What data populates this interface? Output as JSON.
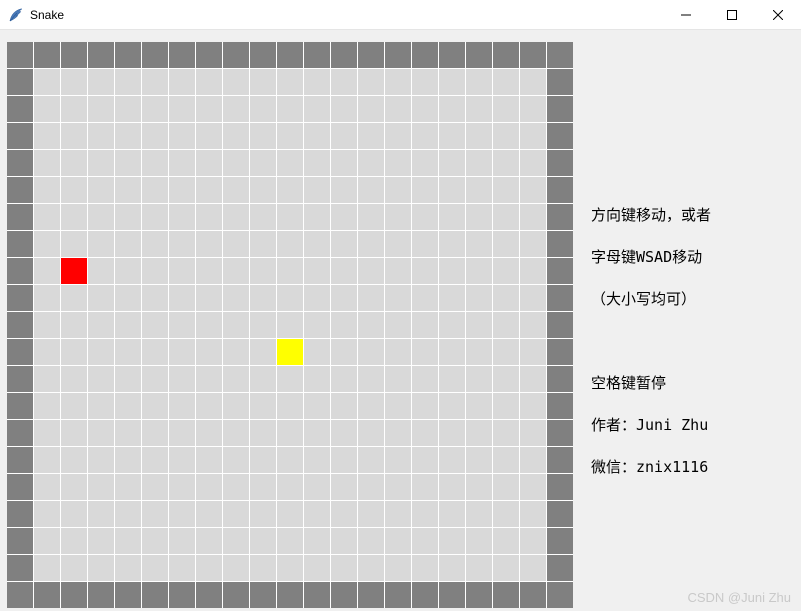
{
  "window": {
    "title": "Snake",
    "icon_name": "feather-icon"
  },
  "titlebar_buttons": {
    "minimize": "—",
    "maximize": "☐",
    "close": "✕"
  },
  "grid": {
    "cols": 21,
    "rows": 21,
    "snake_cell": {
      "row": 8,
      "col": 2
    },
    "food_cell": {
      "row": 11,
      "col": 10
    }
  },
  "instructions": {
    "line1": "方向键移动，或者",
    "line2": "字母键WSAD移动",
    "line3": "（大小写均可）",
    "blank": "",
    "line4": "空格键暂停",
    "line5": "作者：Juni Zhu",
    "line6": "微信：znix1116"
  },
  "watermark": "CSDN @Juni Zhu"
}
